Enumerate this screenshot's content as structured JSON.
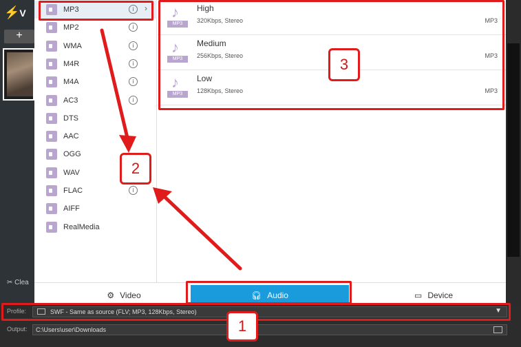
{
  "app": {
    "logo_letter": "V",
    "add_label": "+",
    "clear_label": "Clea"
  },
  "formats": [
    {
      "label": "MP3",
      "info": true,
      "arrow": true,
      "selected": true
    },
    {
      "label": "MP2",
      "info": true
    },
    {
      "label": "WMA",
      "info": true
    },
    {
      "label": "M4R",
      "info": true
    },
    {
      "label": "M4A",
      "info": true
    },
    {
      "label": "AC3",
      "info": true
    },
    {
      "label": "DTS",
      "info": false
    },
    {
      "label": "AAC",
      "info": false
    },
    {
      "label": "OGG",
      "info": false
    },
    {
      "label": "WAV",
      "info": false
    },
    {
      "label": "FLAC",
      "info": true
    },
    {
      "label": "AIFF",
      "info": false
    },
    {
      "label": "RealMedia",
      "info": false
    }
  ],
  "qualities": [
    {
      "title": "High",
      "sub": "320Kbps, Stereo",
      "format": "MP3",
      "badge": "MP3"
    },
    {
      "title": "Medium",
      "sub": "256Kbps, Stereo",
      "format": "MP3",
      "badge": "MP3"
    },
    {
      "title": "Low",
      "sub": "128Kbps, Stereo",
      "format": "MP3",
      "badge": "MP3"
    }
  ],
  "tabs": {
    "video": "Video",
    "audio": "Audio",
    "device": "Device"
  },
  "profile": {
    "label": "Profile:",
    "value": "SWF - Same as source (FLV; MP3, 128Kbps, Stereo)"
  },
  "output": {
    "label": "Output:",
    "value": "C:\\Users\\user\\Downloads"
  },
  "annotations": {
    "one": "1",
    "two": "2",
    "three": "3"
  },
  "colors": {
    "accent": "#1a9bdc",
    "annotation": "#e01b1b",
    "format_icon": "#b9a6cf"
  }
}
